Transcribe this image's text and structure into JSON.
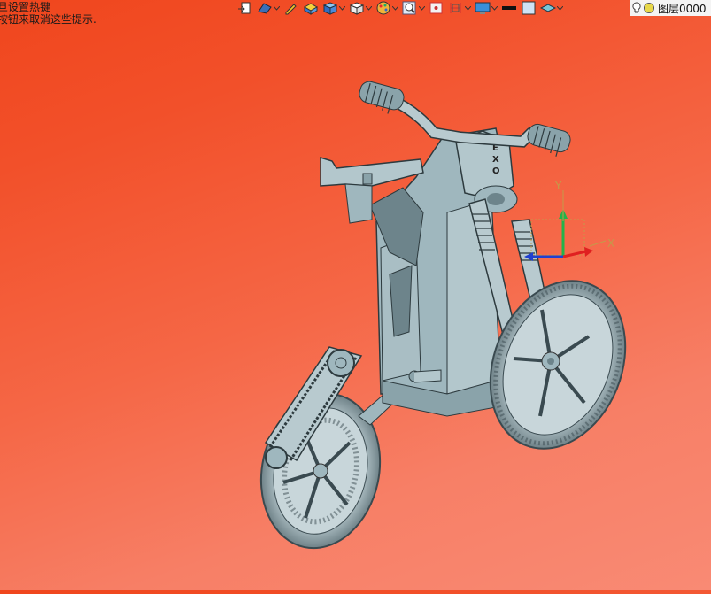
{
  "tips": {
    "line1": "旦设置热键",
    "line2": "按钮来取消这些提示."
  },
  "toolbar": {
    "icons": [
      "export-icon",
      "render-mode-icon",
      "pen-icon",
      "shade-icon",
      "cube-display-icon",
      "view-cube-icon",
      "palette-icon",
      "zoom-icon",
      "fit-view-icon",
      "section-view-icon",
      "monitor-icon",
      "line-color-icon",
      "fill-color-icon",
      "layer-plane-icon"
    ]
  },
  "layer": {
    "label": "图层0000",
    "bulb_icon": "lightbulb-icon",
    "color_icon": "layer-color-dot"
  },
  "triad": {
    "x_label": "X",
    "y_label": "Y"
  },
  "model": {
    "name": "exo-motorcycle-model",
    "badge_letters": [
      "E",
      "X",
      "O"
    ],
    "body_color": "#9fb7be",
    "background_top": "#f0461d",
    "background_bottom": "#f98a74"
  }
}
